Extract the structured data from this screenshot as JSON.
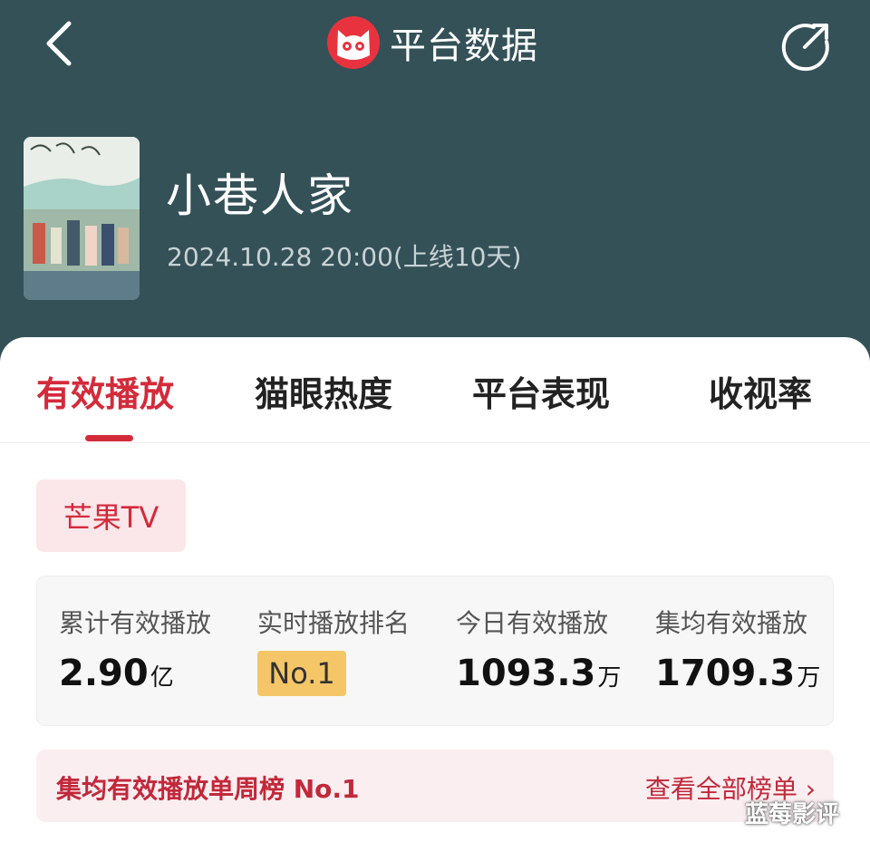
{
  "header": {
    "title": "平台数据",
    "back_icon": "chevron-left-icon",
    "share_icon": "share-icon",
    "brand_logo": "cat-eye-logo"
  },
  "show": {
    "title": "小巷人家",
    "date": "2024.10.28 20:00(上线10天)"
  },
  "tabs": [
    {
      "label": "有效播放",
      "active": true
    },
    {
      "label": "猫眼热度",
      "active": false
    },
    {
      "label": "平台表现",
      "active": false
    },
    {
      "label": "收视率",
      "active": false
    }
  ],
  "platform_chip": "芒果TV",
  "stats": [
    {
      "label": "累计有效播放",
      "value": "2.90",
      "unit": "亿"
    },
    {
      "label": "实时播放排名",
      "value": "No.1",
      "unit": ""
    },
    {
      "label": "今日有效播放",
      "value": "1093.3",
      "unit": "万"
    },
    {
      "label": "集均有效播放",
      "value": "1709.3",
      "unit": "万"
    }
  ],
  "banner": {
    "text": "集均有效播放单周榜 No.1",
    "link": "查看全部榜单",
    "link_icon": "chevron-right-icon"
  },
  "watermark": "蓝莓影评",
  "colors": {
    "header_bg": "#345158",
    "accent": "#d42a3a",
    "badge": "#f5c667",
    "chip_bg": "#fbe6e9"
  }
}
